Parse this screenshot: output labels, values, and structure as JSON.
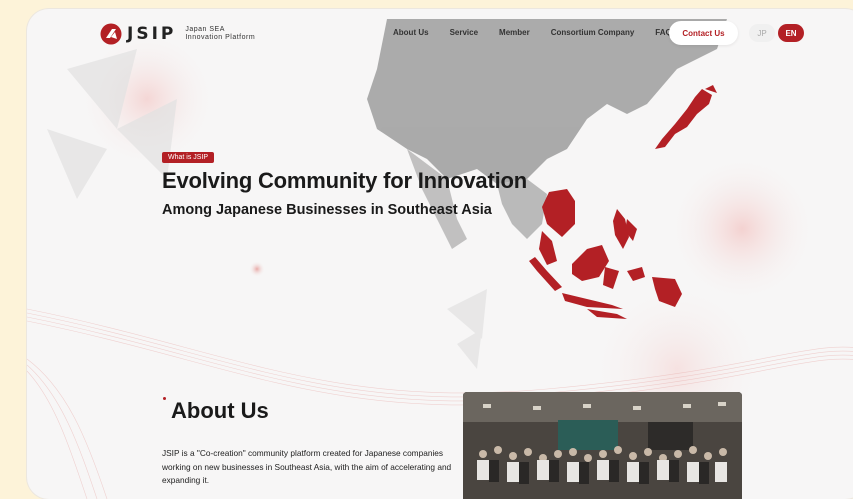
{
  "brand": {
    "name": "JSIP",
    "sub_line1": "Japan SEA",
    "sub_line2": "Innovation Platform"
  },
  "nav": {
    "items": [
      "About Us",
      "Service",
      "Member",
      "Consortium Company",
      "FAQ"
    ],
    "contact": "Contact Us"
  },
  "lang": {
    "jp": "JP",
    "en": "EN",
    "active": "EN"
  },
  "hero": {
    "badge": "What is JSIP",
    "title": "Evolving Community for Innovation",
    "subtitle": "Among Japanese Businesses in Southeast Asia"
  },
  "about": {
    "heading": "About Us",
    "text": "JSIP is a \"Co-creation\" community platform created for Japanese companies working on new businesses in Southeast Asia, with the aim of accelerating and expanding it."
  },
  "colors": {
    "accent": "#b32025",
    "background": "#f7f6f6",
    "page": "#fdf3d9"
  },
  "icons": {
    "logo": "jsip-logo-icon",
    "map": "asia-map-icon"
  }
}
